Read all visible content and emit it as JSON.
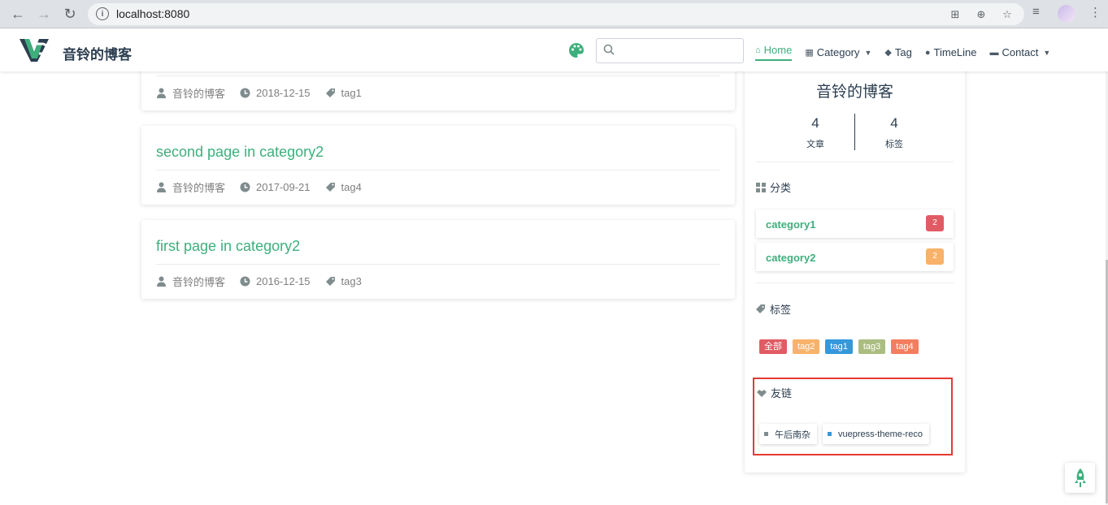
{
  "browser": {
    "url": "localhost:8080"
  },
  "site": {
    "title": "音铃的博客"
  },
  "nav": {
    "items": [
      {
        "label": "Home",
        "active": true,
        "icon": "home-icon"
      },
      {
        "label": "Category",
        "icon": "grid-icon",
        "dropdown": true
      },
      {
        "label": "Tag",
        "icon": "tag-icon"
      },
      {
        "label": "TimeLine",
        "icon": "clock-icon"
      },
      {
        "label": "Contact",
        "icon": "message-icon",
        "dropdown": true
      }
    ]
  },
  "posts": [
    {
      "title": "",
      "author": "音铃的博客",
      "date": "2018-12-15",
      "tag": "tag1"
    },
    {
      "title": "second page in category2",
      "author": "音铃的博客",
      "date": "2017-09-21",
      "tag": "tag4"
    },
    {
      "title": "first page in category2",
      "author": "音铃的博客",
      "date": "2016-12-15",
      "tag": "tag3"
    }
  ],
  "sidebar": {
    "name": "音铃的博客",
    "stats": [
      {
        "num": "4",
        "label": "文章"
      },
      {
        "num": "4",
        "label": "标签"
      }
    ],
    "category_heading": "分类",
    "categories": [
      {
        "name": "category1",
        "count": "2",
        "color": "#e15b64"
      },
      {
        "name": "category2",
        "count": "2",
        "color": "#f8b26a"
      }
    ],
    "tag_heading": "标签",
    "tags": [
      {
        "label": "全部",
        "color": "#e15b64"
      },
      {
        "label": "tag2",
        "color": "#f8b26a"
      },
      {
        "label": "tag1",
        "color": "#3498db"
      },
      {
        "label": "tag3",
        "color": "#abbd81"
      },
      {
        "label": "tag4",
        "color": "#f47e60"
      }
    ],
    "links_heading": "友链",
    "links": [
      {
        "label": "午后南杂",
        "color": "#7f8c8d"
      },
      {
        "label": "vuepress-theme-reco",
        "color": "#3498db"
      }
    ]
  }
}
